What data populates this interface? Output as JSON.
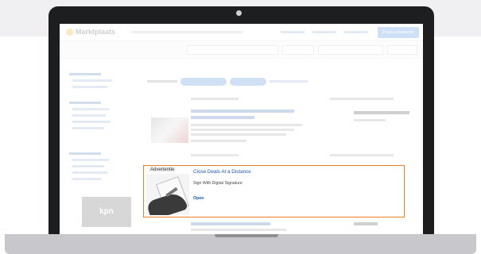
{
  "site": {
    "name": "Marktplaats",
    "place_ad": "Plaats advertentie"
  },
  "sidebar_logo": "kpn",
  "ad": {
    "label": "Advertentie",
    "title": "Close Deals At a Distance",
    "description": "Sign With Digital Signature",
    "cta": "Open"
  },
  "colors": {
    "laptop_bezel": "#1d1e20",
    "ad_border": "#e8802a",
    "link_blue": "#1a56b8",
    "brand_yellow": "#e6a400"
  }
}
